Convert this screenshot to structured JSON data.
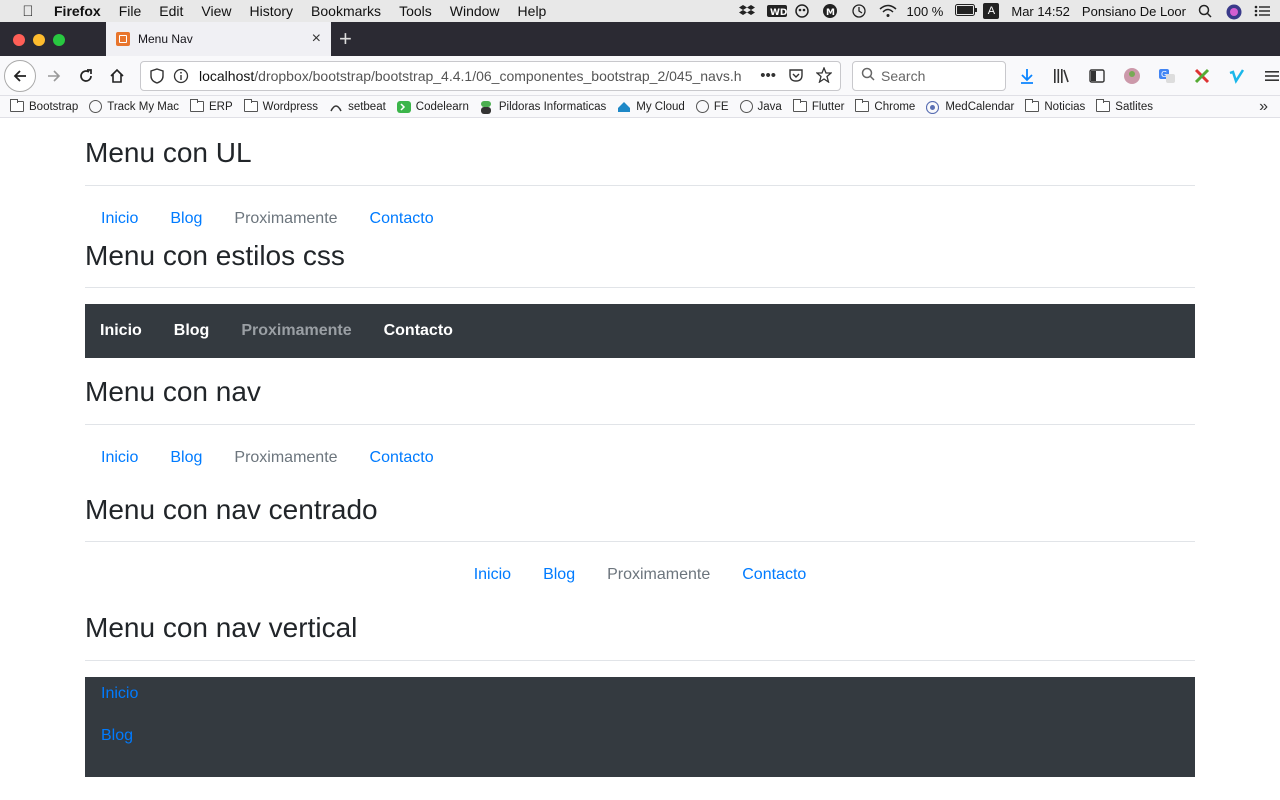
{
  "menubar": {
    "app": "Firefox",
    "items": [
      "File",
      "Edit",
      "View",
      "History",
      "Bookmarks",
      "Tools",
      "Window",
      "Help"
    ],
    "battery": "100 %",
    "input_source": "A",
    "clock": "Mar 14:52",
    "user": "Ponsiano De Loor"
  },
  "tab": {
    "title": "Menu Nav",
    "close": "×",
    "new_tab": "+"
  },
  "urlbar": {
    "host": "localhost",
    "path": "/dropbox/bootstrap/bootstrap_4.4.1/06_componentes_bootstrap_2/045_navs.h",
    "more": "•••"
  },
  "search": {
    "placeholder": "Search"
  },
  "bookmarks": [
    {
      "label": "Bootstrap",
      "icon": "folder-icon"
    },
    {
      "label": "Track My Mac",
      "icon": "globe-icon"
    },
    {
      "label": "ERP",
      "icon": "folder-icon"
    },
    {
      "label": "Wordpress",
      "icon": "folder-icon"
    },
    {
      "label": "setbeat",
      "icon": "setbeat-icon"
    },
    {
      "label": "Codelearn",
      "icon": "codelearn-icon"
    },
    {
      "label": "Pildoras Informaticas",
      "icon": "pildoras-icon"
    },
    {
      "label": "My Cloud",
      "icon": "cloud-icon"
    },
    {
      "label": "FE",
      "icon": "globe-icon"
    },
    {
      "label": "Java",
      "icon": "globe-icon"
    },
    {
      "label": "Flutter",
      "icon": "folder-icon"
    },
    {
      "label": "Chrome",
      "icon": "folder-icon"
    },
    {
      "label": "MedCalendar",
      "icon": "medcalendar-icon"
    },
    {
      "label": "Noticias",
      "icon": "folder-icon"
    },
    {
      "label": "Satlites",
      "icon": "folder-icon"
    }
  ],
  "page": {
    "sections": [
      {
        "title": "Menu con UL",
        "links": [
          "Inicio",
          "Blog",
          "Proximamente",
          "Contacto"
        ]
      },
      {
        "title": "Menu con estilos css",
        "links": [
          "Inicio",
          "Blog",
          "Proximamente",
          "Contacto"
        ]
      },
      {
        "title": "Menu con nav",
        "links": [
          "Inicio",
          "Blog",
          "Proximamente",
          "Contacto"
        ]
      },
      {
        "title": "Menu con nav centrado",
        "links": [
          "Inicio",
          "Blog",
          "Proximamente",
          "Contacto"
        ]
      },
      {
        "title": "Menu con nav vertical",
        "links": [
          "Inicio",
          "Blog"
        ]
      }
    ]
  },
  "colors": {
    "link": "#007bff",
    "disabled": "#6c757d",
    "dark_bg": "#343a40",
    "tabstrip": "#2b2a33"
  }
}
